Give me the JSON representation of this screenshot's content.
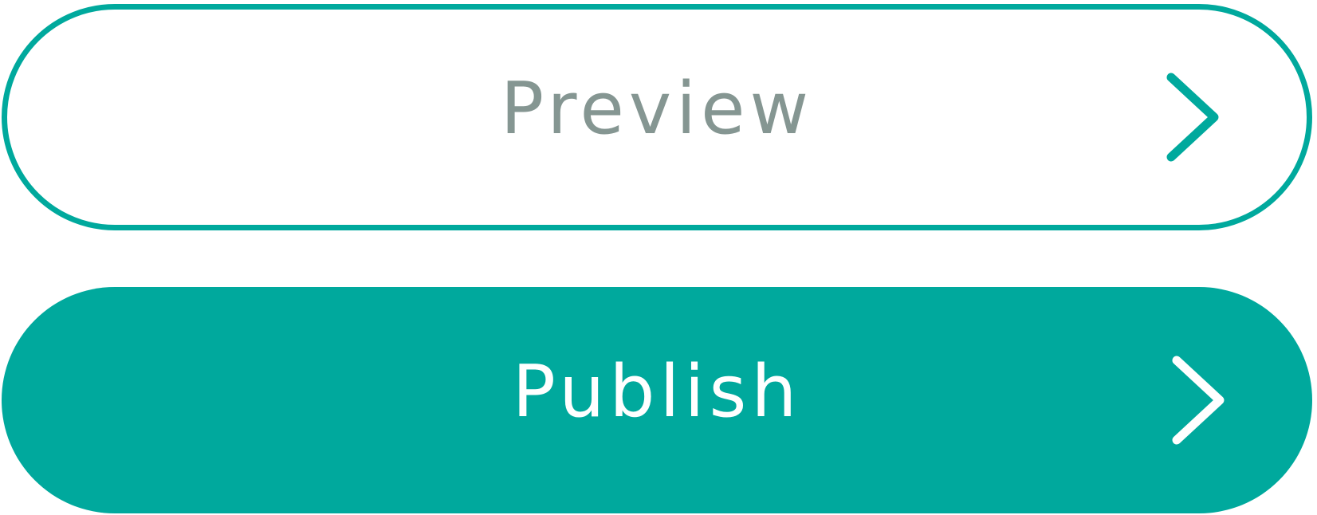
{
  "buttons": {
    "preview": {
      "label": "Preview",
      "icon": "chevron-right-icon"
    },
    "publish": {
      "label": "Publish",
      "icon": "chevron-right-icon"
    }
  },
  "colors": {
    "accent": "#00a99d",
    "preview_text": "#859692",
    "publish_text": "#ffffff",
    "background": "#ffffff"
  }
}
